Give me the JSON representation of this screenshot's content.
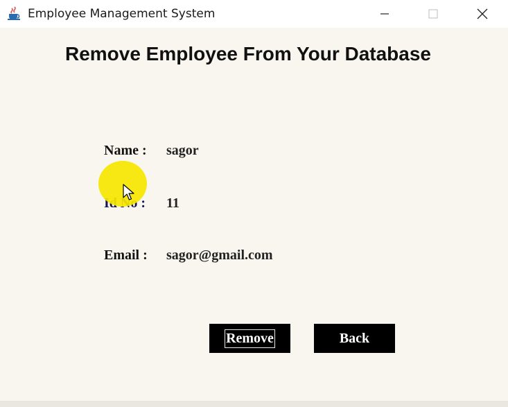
{
  "window": {
    "title": "Employee Management System",
    "app_icon": "java-cup-icon",
    "controls": [
      "minimize-icon",
      "maximize-icon",
      "close-icon"
    ]
  },
  "heading": "Remove Employee From Your Database",
  "fields": {
    "name": {
      "label": "Name :",
      "value": "sagor"
    },
    "id": {
      "label": "Id No :",
      "value": "11"
    },
    "email": {
      "label": "Email :",
      "value": "sagor@gmail.com"
    }
  },
  "buttons": {
    "remove": "Remove",
    "back": "Back"
  },
  "colors": {
    "background": "#f8f6ef",
    "button_bg": "#000000",
    "button_text": "#ffffff",
    "cursor_highlight": "#f6e600"
  }
}
